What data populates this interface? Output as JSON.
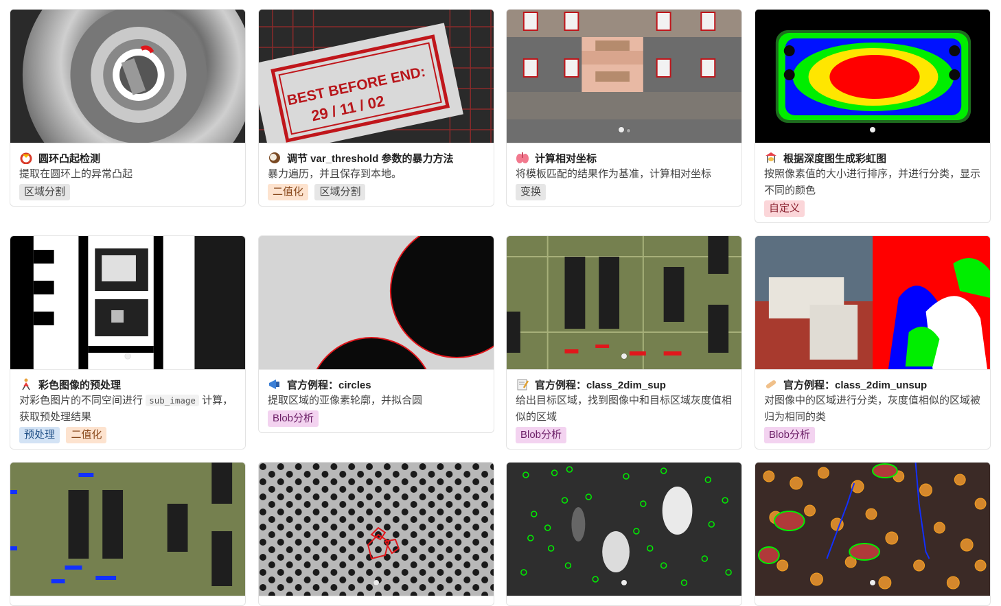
{
  "cards": [
    {
      "title": "圆环凸起检测",
      "desc": "提取在圆环上的异常凸起",
      "tags": [
        "区域分割"
      ]
    },
    {
      "title": "调节 var_threshold 参数的暴力方法",
      "desc": "暴力遍历，并且保存到本地。",
      "tags": [
        "二值化",
        "区域分割"
      ],
      "stamp_line1": "BEST BEFORE END:",
      "stamp_line2": "29 / 11 / 02"
    },
    {
      "title": "计算相对坐标",
      "desc": "将模板匹配的结果作为基准，计算相对坐标",
      "tags": [
        "变换"
      ]
    },
    {
      "title": "根据深度图生成彩虹图",
      "desc": "按照像素值的大小进行排序，并进行分类，显示不同的颜色",
      "tags": [
        "自定义"
      ]
    },
    {
      "title": "彩色图像的预处理",
      "desc_before": "对彩色图片的不同空间进行",
      "desc_code": "sub_image",
      "desc_after": "计算，获取预处理结果",
      "tags": [
        "预处理",
        "二值化"
      ]
    },
    {
      "title": "官方例程：circles",
      "desc": "提取区域的亚像素轮廓，并拟合圆",
      "tags": [
        "Blob分析"
      ]
    },
    {
      "title": "官方例程：class_2dim_sup",
      "desc": "给出目标区域，找到图像中和目标区域灰度值相似的区域",
      "tags": [
        "Blob分析"
      ]
    },
    {
      "title": "官方例程：class_2dim_unsup",
      "desc": "对图像中的区域进行分类，灰度值相似的区域被归为相同的类",
      "tags": [
        "Blob分析"
      ]
    }
  ],
  "icons": [
    "ring-icon",
    "coconut-icon",
    "lungs-icon",
    "carousel-icon",
    "dancer-icon",
    "megaphone-icon",
    "memo-icon",
    "bandage-icon"
  ],
  "colors": {
    "tag_gray": "#e6e6e6",
    "tag_orange": "#fde3cf",
    "tag_pink": "#fbd6d9",
    "tag_purple": "#f3d3f0",
    "tag_blue": "#d3e3f5"
  }
}
